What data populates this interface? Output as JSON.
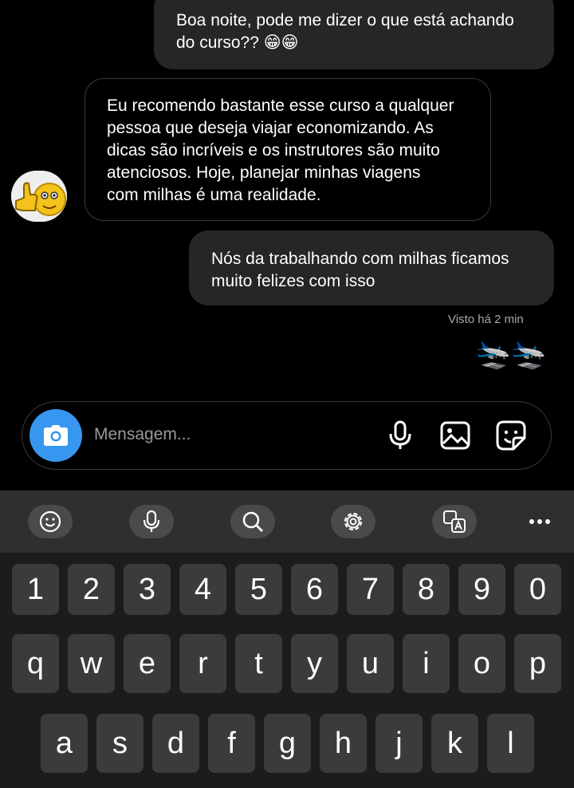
{
  "messages": {
    "sent_1": "Boa noite, pode me dizer o que está achando\ndo curso?? 😁😁",
    "received_1": "Eu recomendo bastante esse curso a qualquer\npessoa que deseja viajar economizando. As\ndicas são incríveis e os instrutores são muito\natenciosos. Hoje, planejar minhas viagens\ncom milhas é uma realidade.",
    "sent_2": "Nós da trabalhando com milhas ficamos\nmuito felizes com isso",
    "seen_status": "Visto há 2 min",
    "reaction": "🛬🛬"
  },
  "avatar": {
    "emoji": "👍🙂"
  },
  "composer": {
    "placeholder": "Mensagem...",
    "icons": [
      "camera-icon",
      "microphone-icon",
      "gallery-icon",
      "sticker-icon"
    ]
  },
  "keyboard": {
    "toolbar_icons": [
      "emoji-icon",
      "voice-input-icon",
      "search-icon",
      "settings-icon",
      "translate-icon",
      "more-icon"
    ],
    "row_numbers": [
      "1",
      "2",
      "3",
      "4",
      "5",
      "6",
      "7",
      "8",
      "9",
      "0"
    ],
    "row_1": [
      "q",
      "w",
      "e",
      "r",
      "t",
      "y",
      "u",
      "i",
      "o",
      "p"
    ],
    "row_2": [
      "a",
      "s",
      "d",
      "f",
      "g",
      "h",
      "j",
      "k",
      "l"
    ]
  },
  "colors": {
    "background": "#000000",
    "bubble": "#262626",
    "accent": "#3797f0",
    "keyboard_bg": "#1c1c1c",
    "key_bg": "#3b3b3b"
  }
}
